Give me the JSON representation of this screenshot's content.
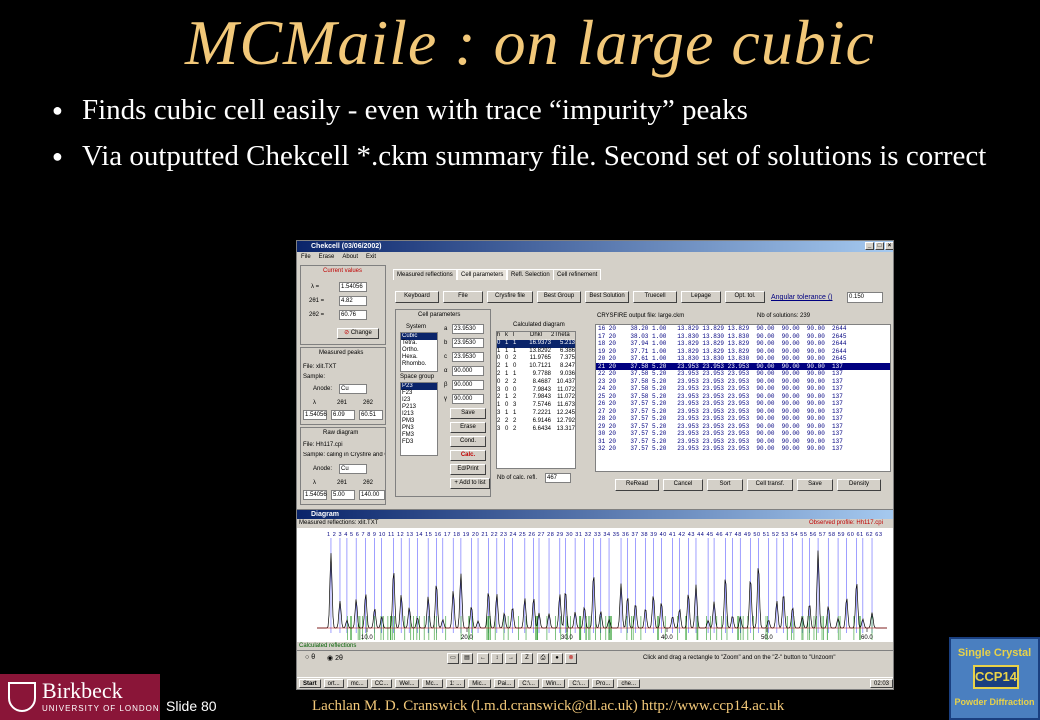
{
  "slide": {
    "title": "MCMaile : on large cubic",
    "bullets": [
      "Finds cubic cell easily - even with trace “impurity” peaks",
      "Via outputted Chekcell *.ckm summary file.  Second set of solutions is correct"
    ],
    "slide_number": "Slide 80",
    "credit": "Lachlan M. D. Cranswick (l.m.d.cranswick@dl.ac.uk) http://www.ccp14.ac.uk",
    "left_logo": {
      "name": "Birkbeck",
      "sub": "UNIVERSITY OF LONDON"
    },
    "right_logo": {
      "line1": "Single Crystal",
      "line2": "CCP14",
      "line3": "Powder Diffraction"
    }
  },
  "app": {
    "title": "Chekcell (03/06/2002)",
    "menu": [
      "File",
      "Erase",
      "About",
      "Exit"
    ],
    "current_values": {
      "heading": "Current values",
      "lambda_label": "λ =",
      "lambda": "1.54056",
      "t1_label": "2θ1 =",
      "t1": "4.82",
      "t2_label": "2θ2 =",
      "t2": "60.76",
      "change": "Change"
    },
    "measured": {
      "heading": "Measured peaks",
      "file": "File: xlit.TXT",
      "sample": "Sample:",
      "anode_label": "Anode:",
      "anode": "Cu",
      "col_lambda": "λ",
      "col_t1": "2θ1",
      "col_t2": "2θ2",
      "v_lambda": "1.54056",
      "v_t1": "6.09",
      "v_t2": "60.51"
    },
    "raw": {
      "heading": "Raw diagram",
      "file": "File: Hh117.cpi",
      "sample": "Sample: caling in Crysfire and C",
      "anode_label": "Anode:",
      "anode": "Cu",
      "col_lambda": "λ",
      "col_t1": "2θ1",
      "col_t2": "2θ2",
      "v_lambda": "1.54056",
      "v_t1": "5.00",
      "v_t2": "140.00"
    },
    "tabs": [
      "Measured reflections",
      "Cell parameters",
      "Refl. Selection",
      "Cell refinement"
    ],
    "toolbar": [
      "Keyboard",
      "File",
      "Crysfire file",
      "Best Group",
      "Best Solution",
      "Truecell",
      "Lepage",
      "Opt. tol."
    ],
    "angular_tolerance_label": "Angular tolerance ()",
    "angular_tolerance": "0.150",
    "cell_params": {
      "heading": "Cell parameters",
      "system_label": "System",
      "systems": [
        "Cubic",
        "Tetra.",
        "Ortho.",
        "Hexa.",
        "Rhombo."
      ],
      "spacegroup_label": "Space group",
      "spacegroups": [
        "P23",
        "F23",
        "I23",
        "P213",
        "I213",
        "PM3",
        "PN3",
        "FM3",
        "FD3"
      ],
      "a_label": "a",
      "a": "23.9530",
      "b_label": "b",
      "b": "23.9530",
      "c_label": "c",
      "c": "23.9530",
      "alpha_label": "α",
      "alpha": "90.000",
      "beta_label": "β",
      "beta": "90.000",
      "gamma_label": "γ",
      "gamma": "90.000",
      "buttons": [
        "Save",
        "Erase",
        "Cond.",
        "Calc.",
        "Ed/Print",
        "+ Add to list"
      ]
    },
    "calculated": {
      "heading": "Calculated diagram",
      "headers": [
        "h",
        "k",
        "l",
        "Dhkl",
        "2Theta"
      ],
      "rows": [
        [
          "0",
          "1",
          "1",
          "16.9373",
          "5.213"
        ],
        [
          "1",
          "1",
          "1",
          "13.8292",
          "6.386"
        ],
        [
          "0",
          "0",
          "2",
          "11.9765",
          "7.375"
        ],
        [
          "2",
          "1",
          "0",
          "10.7121",
          "8.247"
        ],
        [
          "2",
          "1",
          "1",
          "9.7788",
          "9.036"
        ],
        [
          "0",
          "2",
          "2",
          "8.4687",
          "10.437"
        ],
        [
          "3",
          "0",
          "0",
          "7.9843",
          "11.072"
        ],
        [
          "2",
          "1",
          "2",
          "7.9843",
          "11.072"
        ],
        [
          "1",
          "0",
          "3",
          "7.5746",
          "11.673"
        ],
        [
          "3",
          "1",
          "1",
          "7.2221",
          "12.245"
        ],
        [
          "2",
          "2",
          "2",
          "6.9146",
          "12.792"
        ],
        [
          "3",
          "0",
          "2",
          "6.6434",
          "13.317"
        ]
      ],
      "nb_label": "Nb of calc. refl.",
      "nb": "467"
    },
    "crysfire": {
      "file_label": "CRYSFIRE output file: large.ckm",
      "nb_label": "Nb of solutions: 239",
      "rows": [
        "16 20    38.20 1.00   13.829 13.829 13.829  90.00  90.00  90.00  2644",
        "17 20    38.03 1.00   13.830 13.830 13.830  90.00  90.00  90.00  2645",
        "18 20    37.94 1.00   13.829 13.829 13.829  90.00  90.00  90.00  2644",
        "19 20    37.71 1.00   13.829 13.829 13.829  90.00  90.00  90.00  2644",
        "20 20    37.61 1.00   13.830 13.830 13.830  90.00  90.00  90.00  2645",
        "21 20    37.58 5.20   23.953 23.953 23.953  90.00  90.00  90.00  137",
        "22 20    37.58 5.20   23.953 23.953 23.953  90.00  90.00  90.00  137",
        "23 20    37.58 5.20   23.953 23.953 23.953  90.00  90.00  90.00  137",
        "24 20    37.58 5.20   23.953 23.953 23.953  90.00  90.00  90.00  137",
        "25 20    37.58 5.20   23.953 23.953 23.953  90.00  90.00  90.00  137",
        "26 20    37.57 5.20   23.953 23.953 23.953  90.00  90.00  90.00  137",
        "27 20    37.57 5.20   23.953 23.953 23.953  90.00  90.00  90.00  137",
        "28 20    37.57 5.20   23.953 23.953 23.953  90.00  90.00  90.00  137",
        "29 20    37.57 5.20   23.953 23.953 23.953  90.00  90.00  90.00  137",
        "30 20    37.57 5.20   23.953 23.953 23.953  90.00  90.00  90.00  137",
        "31 20    37.57 5.20   23.953 23.953 23.953  90.00  90.00  90.00  137",
        "32 20    37.57 5.20   23.953 23.953 23.953  90.00  90.00  90.00  137"
      ],
      "selected_row": 5,
      "buttons": [
        "ReRead",
        "Cancel",
        "Sort",
        "Cell transf.",
        "Save",
        "Density"
      ]
    },
    "diagram": {
      "title": "Diagram",
      "measured_label": "Measured reflections: xlit.TXT",
      "observed_label": "Observed profile: Hh117.cpi",
      "calculated_label": "Calculated reflections",
      "top_numbers": "1 2  3 4 5  6 7 8 9 10 11 12 13 14 15 16 17 18 19 20 21 22 23 24 25 26 27 28 29 30 31 32 33 34 35 36 37 38 39 40 41 42 43 44 45 46 47 48 49 50 51 52 53 54 55 56 57 58 59 60 61 62 63",
      "axis_labels": [
        "10.0",
        "20.0",
        "30.0",
        "40.0",
        "50.0",
        "60.0"
      ],
      "theta_label": "θ",
      "twotheta_label": "2θ",
      "hint": "Click and drag a rectangle to \"Zoom\" and on the \"Z-\" button to \"Unzoom\""
    },
    "taskbar": {
      "start": "Start",
      "items": [
        "ort...",
        "mc...",
        "CC...",
        "Wel...",
        "Mc...",
        "1: ...",
        "Mic...",
        "Pai...",
        "C:\\...",
        "Win...",
        "C:\\...",
        "Pro...",
        "che..."
      ],
      "clock": "02:03"
    }
  },
  "colors": {
    "title": "#f2c879",
    "credit": "#f2c879",
    "birkbeck": "#8a1538",
    "ccp14_bg": "#4a7fc0"
  }
}
